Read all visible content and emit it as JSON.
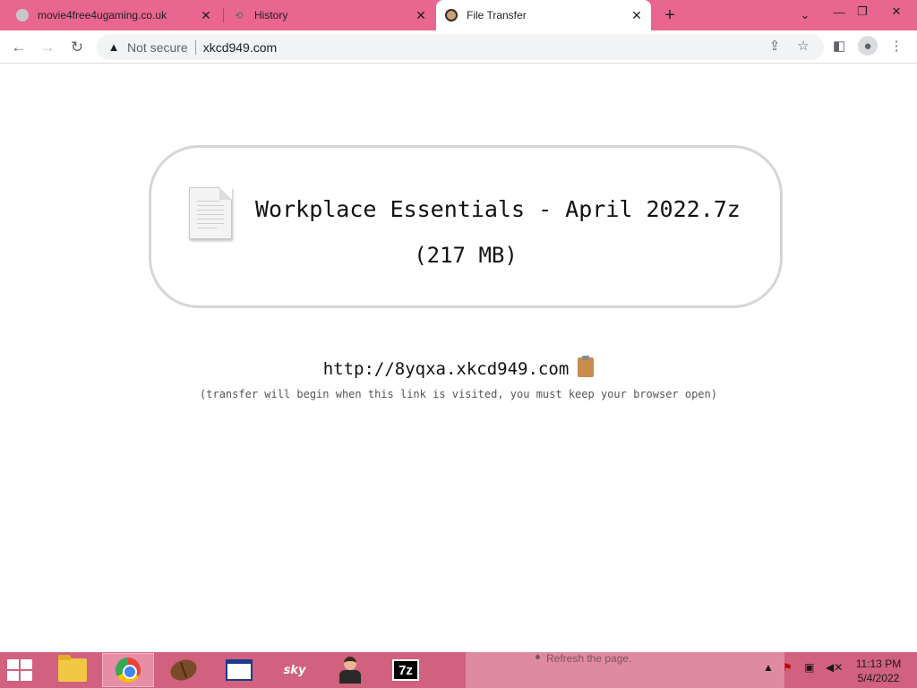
{
  "tabs": [
    {
      "title": "movie4free4ugaming.co.uk",
      "favicon": "globe-icon",
      "active": false
    },
    {
      "title": "History",
      "favicon": "history-icon",
      "active": false
    },
    {
      "title": "File Transfer",
      "favicon": "pug-icon",
      "active": true
    }
  ],
  "toolbar": {
    "security_label": "Not secure",
    "url": "xkcd949.com"
  },
  "file": {
    "name": "Workplace Essentials - April 2022.7z",
    "size": "(217 MB)"
  },
  "transfer": {
    "link": "http://8yqxa.xkcd949.com",
    "note": "(transfer will begin when this link is visited, you must keep your browser open)"
  },
  "taskbar": {
    "items": [
      "file-explorer",
      "chrome",
      "coffee-bean",
      "window-app",
      "sky-app",
      "person-app",
      "7zip"
    ],
    "active_item": "chrome",
    "ghost_text": "Refresh the page.",
    "sky_label": "sky",
    "sevenzip_label": "7z",
    "time": "11:13 PM",
    "date": "5/4/2022"
  },
  "colors": {
    "tab_strip": "#e8668f",
    "taskbar": "#d1617e",
    "clipboard": "#c98b4e"
  }
}
